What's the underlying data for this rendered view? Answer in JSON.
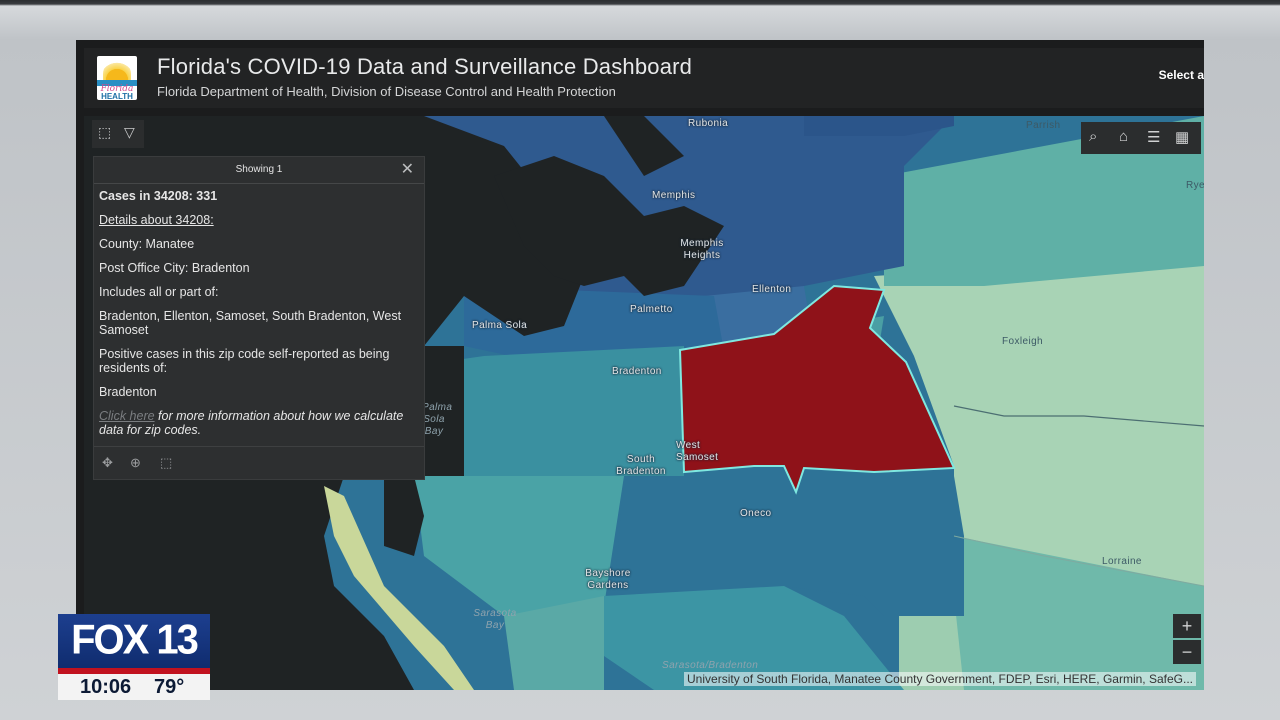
{
  "header": {
    "logo_line1": "Florida",
    "logo_line2": "HEALTH",
    "title": "Florida's COVID-19 Data and Surveillance Dashboard",
    "subtitle": "Florida Department of Health, Division of Disease Control and Health Protection",
    "select_label": "Select a"
  },
  "popup": {
    "header": "Showing 1",
    "cases": "Cases in 34208: 331",
    "details_link": "Details about 34208:",
    "county": "County: Manatee",
    "city": "Post Office City: Bradenton",
    "includes_label": "Includes all or part of:",
    "includes_list": "Bradenton, Ellenton, Samoset, South Bradenton, West Samoset",
    "residents_label": "Positive cases in this zip code self-reported as being residents of:",
    "residents_value": "Bradenton",
    "click_here": "Click here",
    "click_here_rest": " for more information about how we calculate data for zip codes."
  },
  "map": {
    "places": {
      "rubonia": "Rubonia",
      "parrish": "Parrish",
      "rye": "Rye",
      "memphis": "Memphis",
      "memphis_heights": "Memphis Heights",
      "ellenton": "Ellenton",
      "palmetto": "Palmetto",
      "palma_sola": "Palma Sola",
      "palma_sola_bay": "Palma Sola Bay",
      "bradenton": "Bradenton",
      "foxleigh": "Foxleigh",
      "west_samoset": "West Samoset",
      "south_bradenton": "South Bradenton",
      "oneco": "Oneco",
      "bayshore_gardens": "Bayshore Gardens",
      "lorraine": "Lorraine",
      "sarasota_bay": "Sarasota Bay",
      "sarasota_bradenton": "Sarasota/Bradenton"
    },
    "attribution": "University of South Florida, Manatee County Government, FDEP, Esri, HERE, Garmin, SafeG...",
    "zoom_in": "+",
    "zoom_out": "−"
  },
  "colors": {
    "selected_zip": "#8f1219",
    "dark_blue": "#2f5a8f",
    "mid_blue": "#2e7397",
    "teal": "#3a90a0",
    "light_teal": "#5fb0a6",
    "pale_green": "#8cc7ad"
  },
  "overlay": {
    "brand": "FOX 13",
    "time": "10:06",
    "temperature": "79°"
  }
}
